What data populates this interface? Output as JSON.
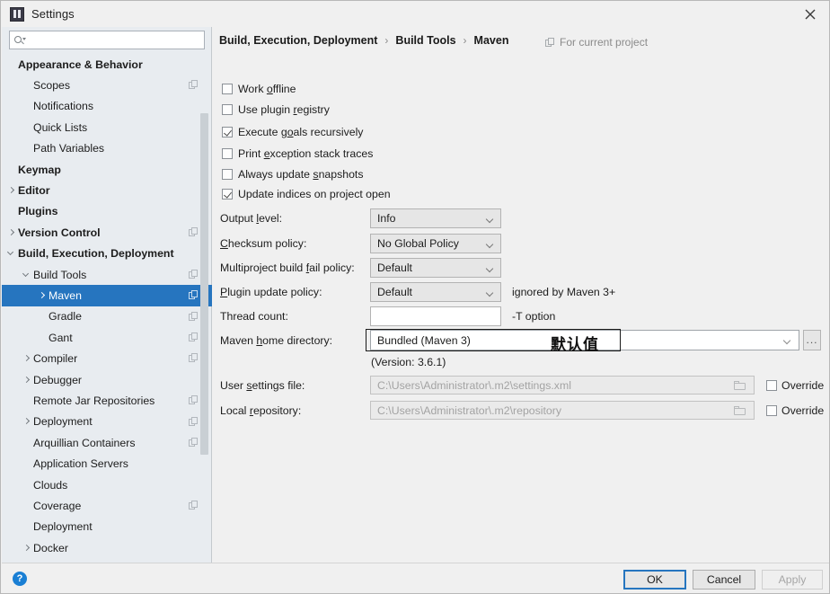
{
  "window": {
    "title": "Settings",
    "app_icon": "intellij-idea-icon",
    "close_icon": "close-icon"
  },
  "search": {
    "value": "",
    "placeholder": "",
    "icon": "search-icon"
  },
  "sidebar": {
    "scrollbar": "vertical-scrollbar",
    "items": [
      {
        "label": "Appearance & Behavior",
        "indent": 0,
        "bold": true,
        "arrow": "",
        "copy": false,
        "selected": false
      },
      {
        "label": "Scopes",
        "indent": 1,
        "bold": false,
        "arrow": "",
        "copy": true,
        "selected": false
      },
      {
        "label": "Notifications",
        "indent": 1,
        "bold": false,
        "arrow": "",
        "copy": false,
        "selected": false
      },
      {
        "label": "Quick Lists",
        "indent": 1,
        "bold": false,
        "arrow": "",
        "copy": false,
        "selected": false
      },
      {
        "label": "Path Variables",
        "indent": 1,
        "bold": false,
        "arrow": "",
        "copy": false,
        "selected": false
      },
      {
        "label": "Keymap",
        "indent": 0,
        "bold": true,
        "arrow": "",
        "copy": false,
        "selected": false
      },
      {
        "label": "Editor",
        "indent": 0,
        "bold": true,
        "arrow": "right",
        "copy": false,
        "selected": false
      },
      {
        "label": "Plugins",
        "indent": 0,
        "bold": true,
        "arrow": "",
        "copy": false,
        "selected": false
      },
      {
        "label": "Version Control",
        "indent": 0,
        "bold": true,
        "arrow": "right",
        "copy": true,
        "selected": false
      },
      {
        "label": "Build, Execution, Deployment",
        "indent": 0,
        "bold": true,
        "arrow": "down",
        "copy": false,
        "selected": false
      },
      {
        "label": "Build Tools",
        "indent": 1,
        "bold": false,
        "arrow": "down",
        "copy": true,
        "selected": false
      },
      {
        "label": "Maven",
        "indent": 2,
        "bold": false,
        "arrow": "right",
        "copy": true,
        "selected": true
      },
      {
        "label": "Gradle",
        "indent": 2,
        "bold": false,
        "arrow": "",
        "copy": true,
        "selected": false
      },
      {
        "label": "Gant",
        "indent": 2,
        "bold": false,
        "arrow": "",
        "copy": true,
        "selected": false
      },
      {
        "label": "Compiler",
        "indent": 1,
        "bold": false,
        "arrow": "right",
        "copy": true,
        "selected": false
      },
      {
        "label": "Debugger",
        "indent": 1,
        "bold": false,
        "arrow": "right",
        "copy": false,
        "selected": false
      },
      {
        "label": "Remote Jar Repositories",
        "indent": 1,
        "bold": false,
        "arrow": "",
        "copy": true,
        "selected": false
      },
      {
        "label": "Deployment",
        "indent": 1,
        "bold": false,
        "arrow": "right",
        "copy": true,
        "selected": false
      },
      {
        "label": "Arquillian Containers",
        "indent": 1,
        "bold": false,
        "arrow": "",
        "copy": true,
        "selected": false
      },
      {
        "label": "Application Servers",
        "indent": 1,
        "bold": false,
        "arrow": "",
        "copy": false,
        "selected": false
      },
      {
        "label": "Clouds",
        "indent": 1,
        "bold": false,
        "arrow": "",
        "copy": false,
        "selected": false
      },
      {
        "label": "Coverage",
        "indent": 1,
        "bold": false,
        "arrow": "",
        "copy": true,
        "selected": false
      },
      {
        "label": "Deployment",
        "indent": 1,
        "bold": false,
        "arrow": "",
        "copy": false,
        "selected": false
      },
      {
        "label": "Docker",
        "indent": 1,
        "bold": false,
        "arrow": "right",
        "copy": false,
        "selected": false
      }
    ]
  },
  "breadcrumb": {
    "parts": [
      "Build, Execution, Deployment",
      "Build Tools",
      "Maven"
    ],
    "separator": "›",
    "scope_label": "For current project",
    "scope_icon": "project-scope-icon"
  },
  "checkboxes": [
    {
      "label_pre": "Work ",
      "mnemonic": "o",
      "label_post": "ffline",
      "checked": false
    },
    {
      "label_pre": "Use plugin ",
      "mnemonic": "r",
      "label_post": "egistry",
      "checked": false
    },
    {
      "label_pre": "Execute g",
      "mnemonic": "o",
      "label_post": "als recursively",
      "checked": true
    },
    {
      "label_pre": "Print ",
      "mnemonic": "e",
      "label_post": "xception stack traces",
      "checked": false
    },
    {
      "label_pre": "Always update ",
      "mnemonic": "s",
      "label_post": "napshots",
      "checked": false
    },
    {
      "label_pre": "Update indices on project open",
      "mnemonic": "",
      "label_post": "",
      "checked": true
    }
  ],
  "fields": {
    "output_level": {
      "label_pre": "Output ",
      "mnemonic": "l",
      "label_post": "evel:",
      "value": "Info"
    },
    "checksum": {
      "label_pre": "",
      "mnemonic": "C",
      "label_post": "hecksum policy:",
      "value": "No Global Policy"
    },
    "multiproject": {
      "label_pre": "Multiproject build ",
      "mnemonic": "f",
      "label_post": "ail policy:",
      "value": "Default"
    },
    "plugin_update": {
      "label_pre": "",
      "mnemonic": "P",
      "label_post": "lugin update policy:",
      "value": "Default",
      "hint": "ignored by Maven 3+"
    },
    "thread_count": {
      "label_pre": "Thread count:",
      "mnemonic": "",
      "label_post": "",
      "value": "",
      "hint": "-T option"
    },
    "maven_home": {
      "label_pre": "Maven ",
      "mnemonic": "h",
      "label_post": "ome directory:",
      "value": "Bundled (Maven 3)",
      "browse_label": "...",
      "version_note": "(Version: 3.6.1)"
    },
    "user_settings": {
      "label_pre": "User ",
      "mnemonic": "s",
      "label_post": "ettings file:",
      "value": "C:\\Users\\Administrator\\.m2\\settings.xml",
      "override_label": "Override",
      "override_checked": false
    },
    "local_repo": {
      "label_pre": "Local ",
      "mnemonic": "r",
      "label_post": "epository:",
      "value": "C:\\Users\\Administrator\\.m2\\repository",
      "override_label": "Override",
      "override_checked": false
    }
  },
  "annotation": {
    "text": "默认值"
  },
  "footer": {
    "help_label": "?",
    "ok_label": "OK",
    "cancel_label": "Cancel",
    "apply_label": "Apply"
  },
  "colors": {
    "selection": "#2675bf",
    "sidebar_bg": "#e8ecf0",
    "panel_bg": "#f0f0f0",
    "help_blue": "#1a7fd4"
  }
}
